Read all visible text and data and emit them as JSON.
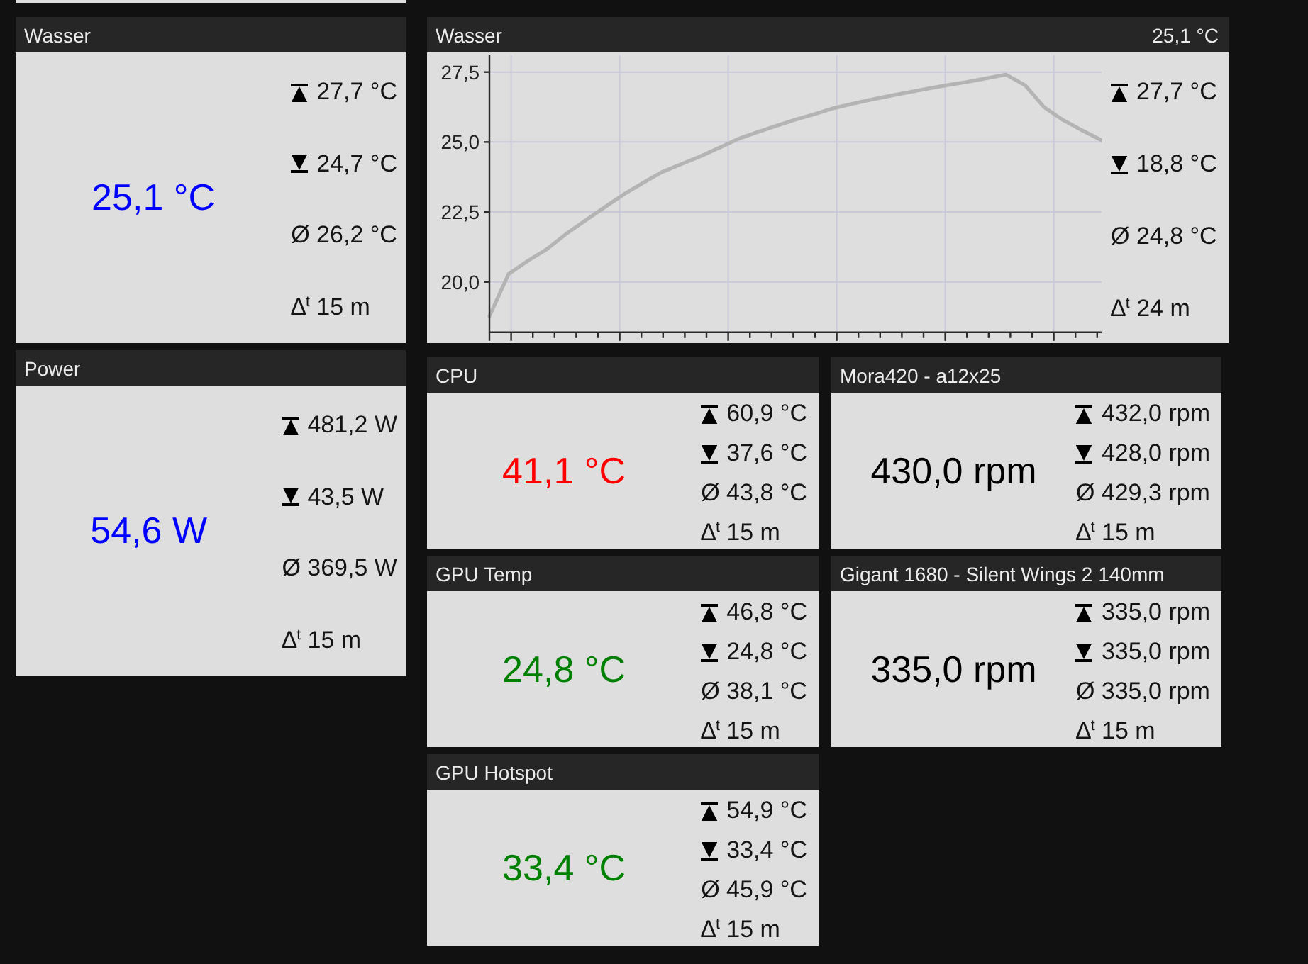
{
  "left_column": {
    "widgets": [
      {
        "title": "Wasser",
        "value": "25,1 °C",
        "color": "#0000ff",
        "stats": [
          {
            "kind": "max",
            "text": "27,7 °C"
          },
          {
            "kind": "min",
            "text": "24,7 °C"
          },
          {
            "kind": "avg",
            "text": "Ø 26,2 °C"
          },
          {
            "kind": "span",
            "text": "∆$^{t}$ 15 m"
          }
        ]
      },
      {
        "title": "Power",
        "value": "54,6 W",
        "color": "#0000ff",
        "stats": [
          {
            "kind": "max",
            "text": "481,2 W"
          },
          {
            "kind": "min",
            "text": "43,5 W"
          },
          {
            "kind": "avg",
            "text": "Ø 369,5 W"
          },
          {
            "kind": "span",
            "text": "∆$^{t}$ 15 m"
          }
        ]
      }
    ]
  },
  "right_column": {
    "chart_widget": {
      "title": "Wasser",
      "value": "25,1 °C",
      "chart_data": {
        "type": "line",
        "grid": true,
        "series": [
          {
            "color": "#b4b4b4",
            "values": [
              18.78,
              20.28,
              20.75,
              21.17,
              21.71,
              22.19,
              22.66,
              23.12,
              23.53,
              23.92,
              24.2,
              24.48,
              24.79,
              25.11,
              25.35,
              25.58,
              25.8,
              26.0,
              26.21,
              26.37,
              26.52,
              26.66,
              26.79,
              26.92,
              27.04,
              27.15,
              27.28,
              27.41,
              27.03,
              26.24,
              25.78,
              25.41,
              25.06
            ]
          }
        ],
        "ylim": [
          18.2,
          28.1
        ],
        "yticks": [
          {
            "value": 20,
            "label": "20,0"
          },
          {
            "value": 22.5,
            "label": "22,5"
          },
          {
            "value": 25,
            "label": "25,0"
          },
          {
            "value": 27.5,
            "label": "27,5"
          }
        ]
      },
      "stats": [
        {
          "kind": "max",
          "text": "27,7 °C"
        },
        {
          "kind": "min",
          "text": "18,8 °C"
        },
        {
          "kind": "avg",
          "text": "Ø 24,8 °C"
        },
        {
          "kind": "span",
          "text": "∆$^{t}$ 24 m"
        }
      ]
    },
    "widgets": [
      {
        "title": "CPU",
        "value": "41,1 °C",
        "color": "#ff0000",
        "stats": [
          {
            "kind": "max",
            "text": "60,9 °C"
          },
          {
            "kind": "min",
            "text": "37,6 °C"
          },
          {
            "kind": "avg",
            "text": "Ø 43,8 °C"
          },
          {
            "kind": "span",
            "text": "∆$^{t}$ 15 m"
          }
        ]
      },
      {
        "title": "Mora420 - a12x25",
        "value": "430,0 rpm",
        "color": "#000000",
        "stats": [
          {
            "kind": "max",
            "text": "432,0 rpm"
          },
          {
            "kind": "min",
            "text": "428,0 rpm"
          },
          {
            "kind": "avg",
            "text": "Ø 429,3 rpm"
          },
          {
            "kind": "span",
            "text": "∆$^{t}$ 15 m"
          }
        ]
      },
      {
        "title": "GPU Temp",
        "value": "24,8 °C",
        "color": "#008000",
        "stats": [
          {
            "kind": "max",
            "text": "46,8 °C"
          },
          {
            "kind": "min",
            "text": "24,8 °C"
          },
          {
            "kind": "avg",
            "text": "Ø 38,1 °C"
          },
          {
            "kind": "span",
            "text": "∆$^{t}$ 15 m"
          }
        ]
      },
      {
        "title": "Gigant 1680 - Silent Wings 2 140mm",
        "value": "335,0 rpm",
        "color": "#000000",
        "stats": [
          {
            "kind": "max",
            "text": "335,0 rpm"
          },
          {
            "kind": "min",
            "text": "335,0 rpm"
          },
          {
            "kind": "avg",
            "text": "Ø 335,0 rpm"
          },
          {
            "kind": "span",
            "text": "∆$^{t}$ 15 m"
          }
        ]
      },
      {
        "title": "GPU Hotspot",
        "value": "33,4 °C",
        "color": "#008000",
        "stats": [
          {
            "kind": "max",
            "text": "54,9 °C"
          },
          {
            "kind": "min",
            "text": "33,4 °C"
          },
          {
            "kind": "avg",
            "text": "Ø 45,9 °C"
          },
          {
            "kind": "span",
            "text": "∆$^{t}$ 15 m"
          }
        ]
      }
    ]
  }
}
